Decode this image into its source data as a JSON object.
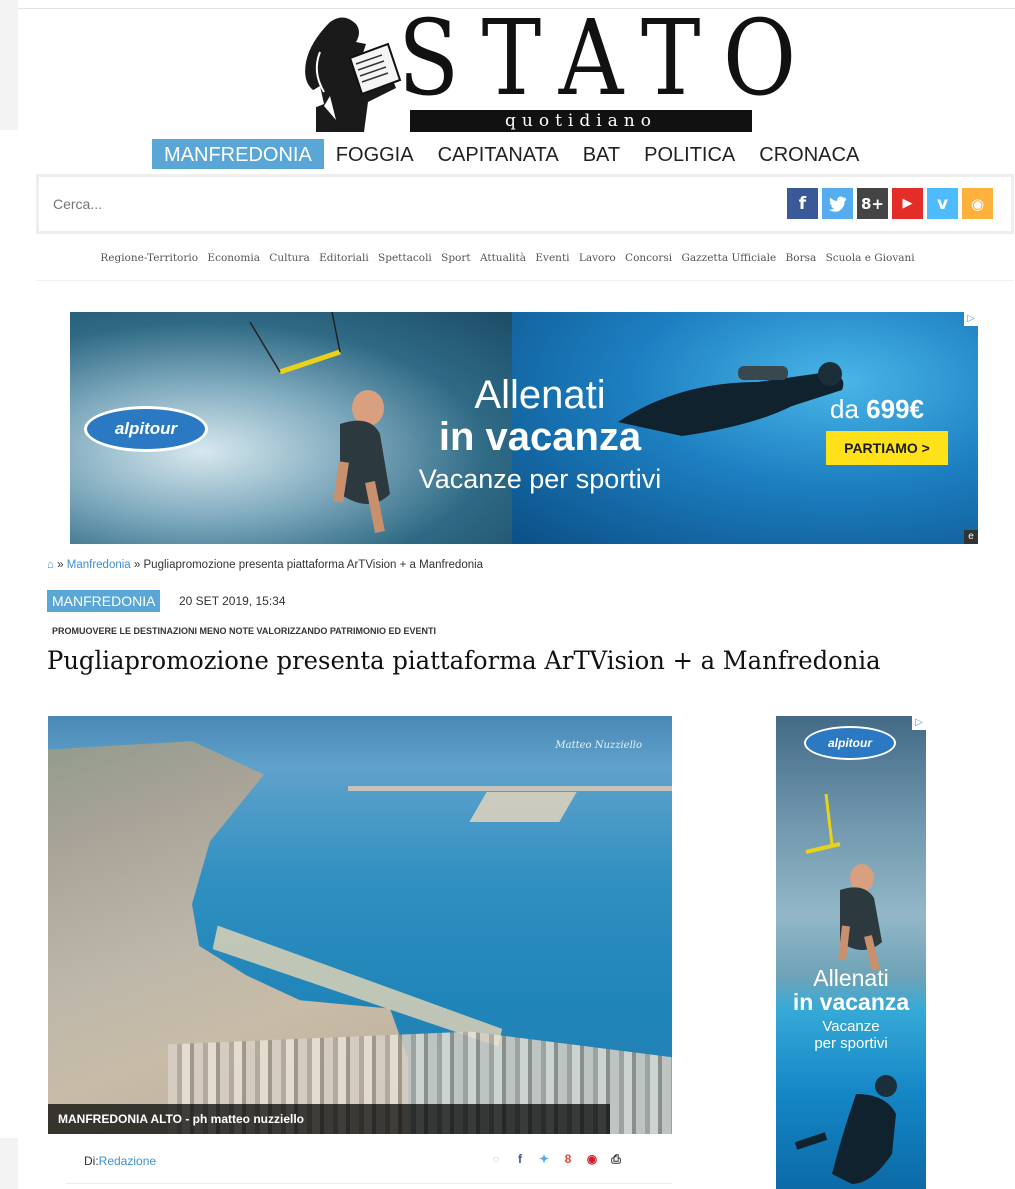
{
  "masthead": {
    "word": "STATO",
    "tagline": "quotidiano"
  },
  "main_nav": [
    {
      "label": "MANFREDONIA",
      "active": true
    },
    {
      "label": "FOGGIA",
      "active": false
    },
    {
      "label": "CAPITANATA",
      "active": false
    },
    {
      "label": "BAT",
      "active": false
    },
    {
      "label": "POLITICA",
      "active": false
    },
    {
      "label": "CRONACA",
      "active": false
    }
  ],
  "search": {
    "placeholder": "Cerca..."
  },
  "social": [
    {
      "icon": "facebook-icon",
      "glyph": "f",
      "color": "#3b5998"
    },
    {
      "icon": "twitter-icon",
      "glyph": "🐦",
      "color": "#55acee"
    },
    {
      "icon": "google-plus-icon",
      "glyph": "8+",
      "color": "#444444"
    },
    {
      "icon": "youtube-icon",
      "glyph": "▶",
      "color": "#e52d27"
    },
    {
      "icon": "vimeo-icon",
      "glyph": "v",
      "color": "#4ebbff"
    },
    {
      "icon": "rss-icon",
      "glyph": "◉",
      "color": "#ffb13d"
    }
  ],
  "sub_nav": [
    "Regione-Territorio",
    "Economia",
    "Cultura",
    "Editoriali",
    "Spettacoli",
    "Sport",
    "Attualità",
    "Eventi",
    "Lavoro",
    "Concorsi",
    "Gazzetta Ufficiale",
    "Borsa",
    "Scuola e Giovani"
  ],
  "banner_ad": {
    "brand": "alpitour",
    "headline_1": "Allenati",
    "headline_2": "in vacanza",
    "subline": "Vacanze per sportivi",
    "price_prefix": "da",
    "price": "699€",
    "cta": "PARTIAMO >"
  },
  "breadcrumb": {
    "home_icon": "home-icon",
    "sep": "»",
    "category": "Manfredonia",
    "current": "Pugliapromozione presenta piattaforma ArTVision + a Manfredonia"
  },
  "article": {
    "category": "MANFREDONIA",
    "date": "20 SET 2019, 15:34",
    "kicker": "PROMUOVERE LE DESTINAZIONI MENO NOTE VALORIZZANDO PATRIMONIO ED EVENTI",
    "title": "Pugliapromozione presenta piattaforma ArTVision + a Manfredonia",
    "photo_caption": "MANFREDONIA ALTO - ph matteo nuzziello",
    "photo_signature": "Matteo Nuzziello",
    "byline_prefix": "Di:",
    "author": "Redazione",
    "share_icons": [
      "comment-icon",
      "facebook-icon",
      "twitter-icon",
      "google-plus-icon",
      "pinterest-icon",
      "print-icon"
    ]
  },
  "side_ad": {
    "brand": "alpitour",
    "headline_1": "Allenati",
    "headline_2": "in vacanza",
    "subline_1": "Vacanze",
    "subline_2": "per sportivi"
  }
}
